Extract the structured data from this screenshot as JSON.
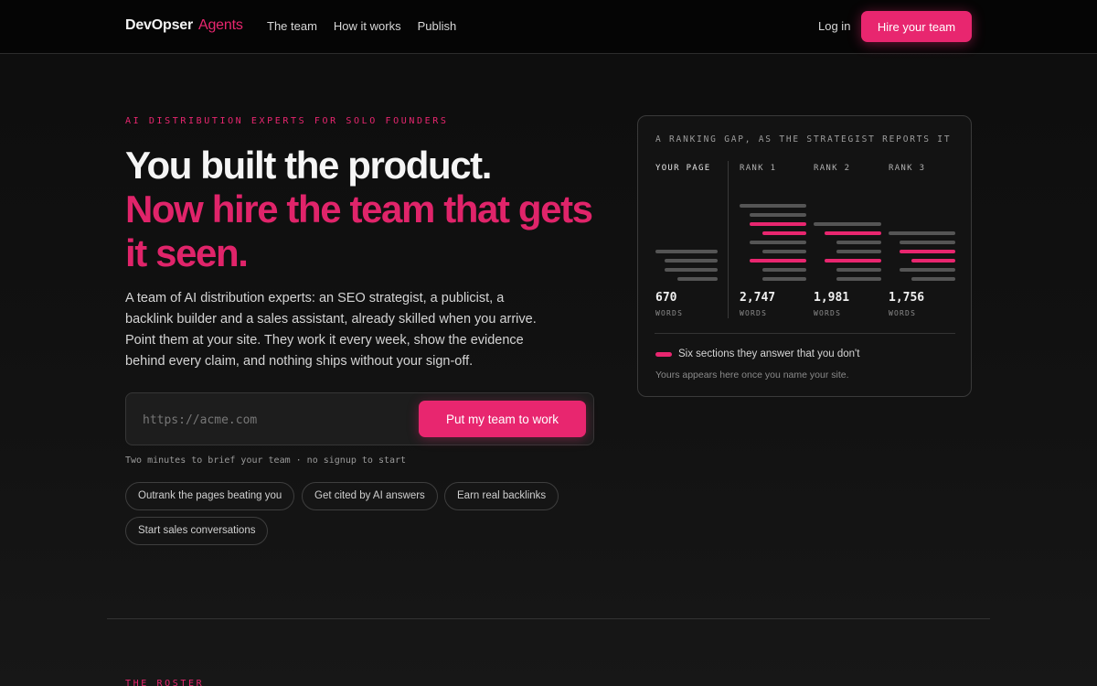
{
  "nav": {
    "brand": "DevOpser",
    "brand_sub": "Agents",
    "links": [
      "The team",
      "How it works",
      "Publish"
    ],
    "login": "Log in",
    "cta": "Hire your team"
  },
  "hero": {
    "eyebrow": "AI DISTRIBUTION EXPERTS FOR SOLO FOUNDERS",
    "headline_1": "You built the product.",
    "headline_2": "Now hire the team that gets it seen.",
    "lead": "A team of AI distribution experts: an SEO strategist, a publicist, a backlink builder and a sales assistant, already skilled when you arrive. Point them at your site. They work it every week, show the evidence behind every claim, and nothing ships without your sign-off.",
    "url_placeholder": "https://acme.com",
    "submit": "Put my team to work",
    "hint": "Two minutes to brief your team · no signup to start",
    "chips": [
      "Outrank the pages beating you",
      "Get cited by AI answers",
      "Earn real backlinks",
      "Start sales conversations"
    ]
  },
  "card": {
    "title": "A RANKING GAP, AS THE STRATEGIST REPORTS IT",
    "columns": [
      {
        "label": "YOUR PAGE",
        "value": "670",
        "unit": "WORDS"
      },
      {
        "label": "RANK 1",
        "value": "2,747",
        "unit": "WORDS"
      },
      {
        "label": "RANK 2",
        "value": "1,981",
        "unit": "WORDS"
      },
      {
        "label": "RANK 3",
        "value": "1,756",
        "unit": "WORDS"
      }
    ],
    "legend": "Six sections they answer that you don't",
    "footnote": "Yours appears here once you name your site."
  },
  "next_section": {
    "eyebrow": "THE ROSTER"
  },
  "colors": {
    "accent": "#e8266f",
    "background": "#0d0d0d",
    "bar_gray": "#555555"
  }
}
